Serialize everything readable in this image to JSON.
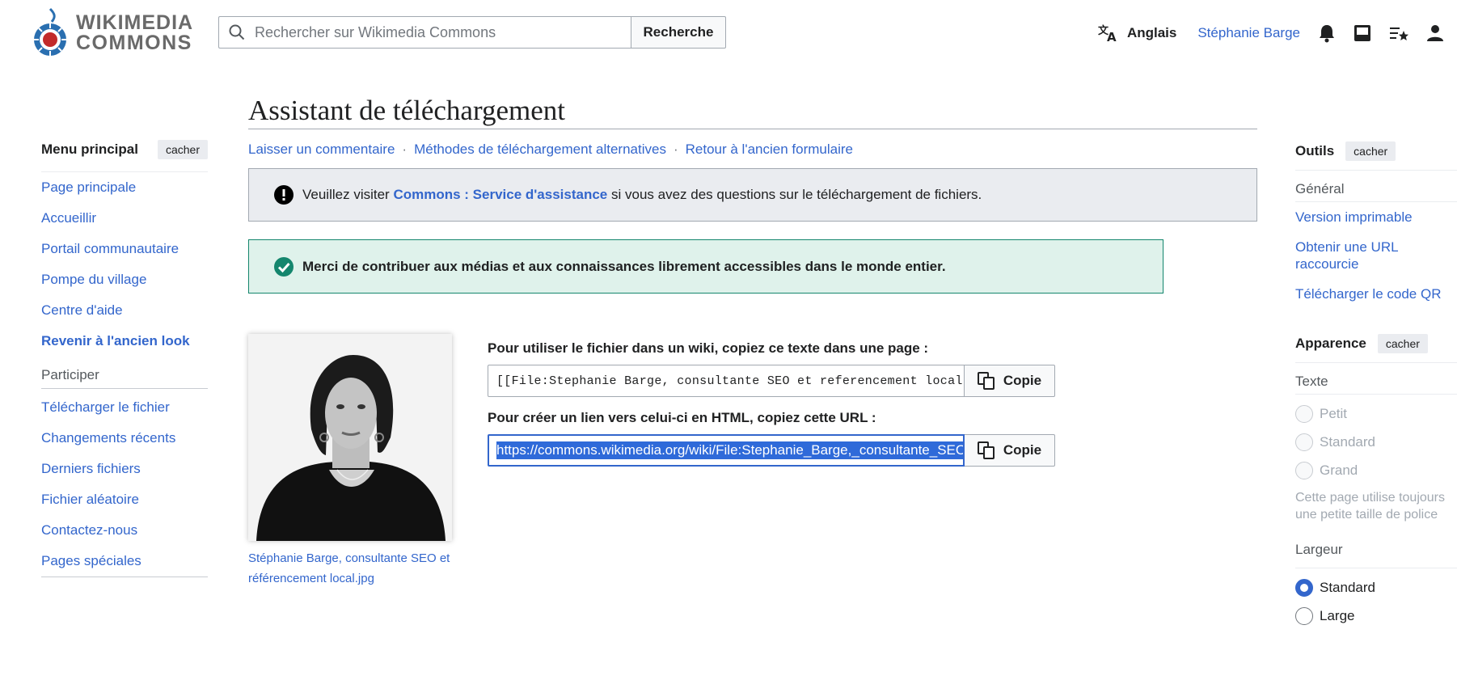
{
  "header": {
    "logo_line1": "WIKIMEDIA",
    "logo_line2": "COMMONS",
    "search_placeholder": "Rechercher sur Wikimedia Commons",
    "search_button": "Recherche",
    "language": "Anglais",
    "username": "Stéphanie Barge",
    "icons": [
      "translate-icon",
      "bell-icon",
      "inbox-icon",
      "watchlist-icon",
      "user-icon"
    ]
  },
  "left_nav": {
    "title": "Menu principal",
    "hide_label": "cacher",
    "items": [
      {
        "label": "Page principale"
      },
      {
        "label": "Accueillir"
      },
      {
        "label": "Portail communautaire"
      },
      {
        "label": "Pompe du village"
      },
      {
        "label": "Centre d'aide"
      },
      {
        "label": "Revenir à l'ancien look"
      }
    ],
    "section_participate": "Participer",
    "items2": [
      {
        "label": "Télécharger le fichier"
      },
      {
        "label": "Changements récents"
      },
      {
        "label": "Derniers fichiers"
      },
      {
        "label": "Fichier aléatoire"
      },
      {
        "label": "Contactez-nous"
      },
      {
        "label": "Pages spéciales"
      }
    ]
  },
  "main": {
    "title": "Assistant de téléchargement",
    "links": [
      "Laisser un commentaire",
      "Méthodes de téléchargement alternatives",
      "Retour à l'ancien formulaire"
    ],
    "separator": "·",
    "notice_prefix": "Veuillez visiter ",
    "notice_link": "Commons : Service d'assistance",
    "notice_suffix": " si vous avez des questions sur le téléchargement de fichiers.",
    "success_message": "Merci de contribuer aux médias et aux connaissances librement accessibles dans le monde entier.",
    "caption": "Stéphanie Barge, consultante SEO et référencement local.jpg",
    "wiki_label": "Pour utiliser le fichier dans un wiki, copiez ce texte dans une page :",
    "wiki_text": "[[File:Stephanie Barge, consultante SEO et referencement local.jpg|thumb|Stéphanie Barge]]",
    "html_label": "Pour créer un lien vers celui-ci en HTML, copiez cette URL :",
    "html_url": "https://commons.wikimedia.org/wiki/File:Stephanie_Barge,_consultante_SEO_et_referencement_local.jpg",
    "copy_button": "Copie"
  },
  "right_nav": {
    "tools_title": "Outils",
    "hide_label": "cacher",
    "general": "Général",
    "tools": [
      {
        "label": "Version imprimable"
      },
      {
        "label": "Obtenir une URL raccourcie"
      },
      {
        "label": "Télécharger le code QR"
      }
    ],
    "appearance_title": "Apparence",
    "text_section": "Texte",
    "text_options": [
      "Petit",
      "Standard",
      "Grand"
    ],
    "text_note": "Cette page utilise toujours une petite taille de police",
    "width_section": "Largeur",
    "width_options": [
      "Standard",
      "Large"
    ],
    "width_selected": "Standard"
  },
  "colors": {
    "link": "#3366cc",
    "notice_bg": "#eaecf0",
    "success_bg": "#dff2eb",
    "success_border": "#14866d",
    "selection": "#2f6ad9"
  }
}
